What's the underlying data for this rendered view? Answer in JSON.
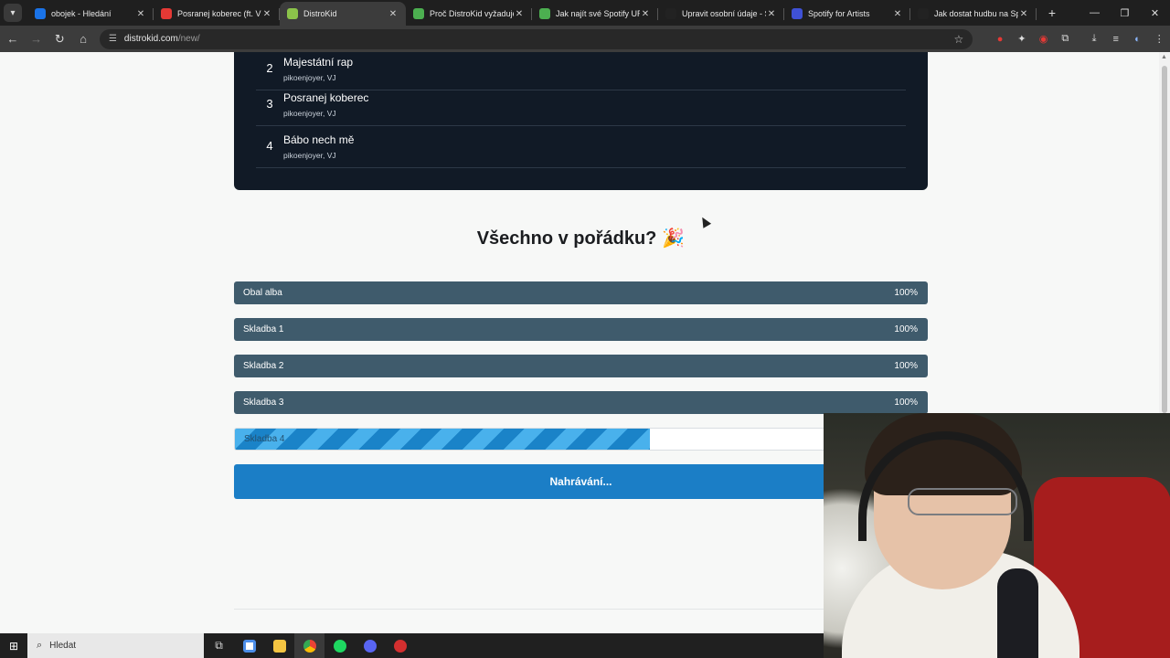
{
  "browser": {
    "tabs": [
      {
        "title": "obojek - Hledání",
        "color": "#1a73e8",
        "active": false
      },
      {
        "title": "Posranej koberec (ft. V",
        "color": "#e53935",
        "active": false
      },
      {
        "title": "DistroKid",
        "color": "#8bc34a",
        "active": true
      },
      {
        "title": "Proč DistroKid vyžaduje s",
        "color": "#4caf50",
        "active": false
      },
      {
        "title": "Jak najít své Spotify URI k",
        "color": "#4caf50",
        "active": false
      },
      {
        "title": "Upravit osobní údaje - Sp",
        "color": "#222222",
        "active": false
      },
      {
        "title": "Spotify for Artists",
        "color": "#3f51d6",
        "active": false
      },
      {
        "title": "Jak dostat hudbu na Spoti",
        "color": "#222222",
        "active": false
      }
    ],
    "url_host": "distrokid.com",
    "url_path": "/new/"
  },
  "tracklist": [
    {
      "number": "2",
      "title": "Majestátní rap",
      "artists": "pikoenjoyer, VJ"
    },
    {
      "number": "3",
      "title": "Posranej koberec",
      "artists": "pikoenjoyer, VJ"
    },
    {
      "number": "4",
      "title": "Bábo nech mě",
      "artists": "pikoenjoyer, VJ"
    }
  ],
  "heading": "Všechno v pořádku?",
  "uploads": [
    {
      "label": "Obal alba",
      "percent": "100%"
    },
    {
      "label": "Skladba 1",
      "percent": "100%"
    },
    {
      "label": "Skladba 2",
      "percent": "100%"
    },
    {
      "label": "Skladba 3",
      "percent": "100%"
    }
  ],
  "current_upload": {
    "label": "Skladba 4",
    "progress": 0.6
  },
  "upload_button": "Nahrávání...",
  "taskbar": {
    "search_placeholder": "Hledat"
  }
}
